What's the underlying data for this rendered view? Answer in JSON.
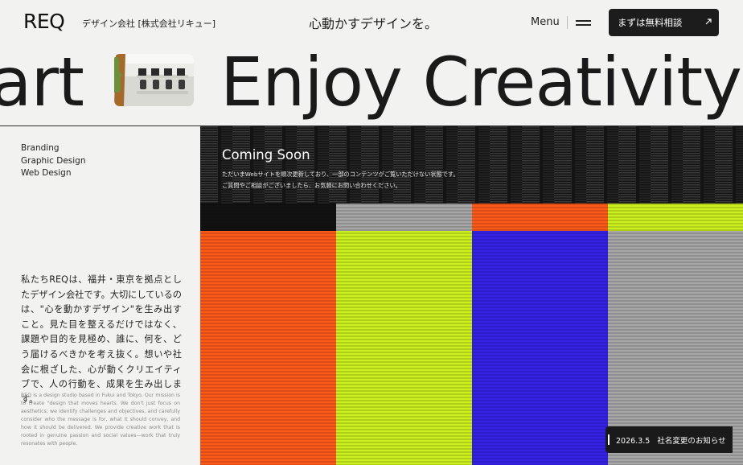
{
  "header": {
    "logo": "REQ",
    "company": "デザイン会社 [株式会社リキュー]",
    "tagline": "心動かすデザインを。",
    "menu_label": "Menu",
    "cta_label": "まずは無料相談",
    "cta_icon": "arrow-up-right-icon",
    "menu_icon": "hamburger-icon"
  },
  "marquee": {
    "left_text": "art",
    "right_text": "Enjoy Creativity"
  },
  "services": [
    "Branding",
    "Graphic Design",
    "Web Design"
  ],
  "intro": {
    "ja": "私たちREQは、福井・東京を拠点としたデザイン会社です。大切にしているのは、\"心を動かすデザイン\"を生み出すこと。見た目を整えるだけではなく、課題や目的を見極め、誰に、何を、どう届けるべきかを考え抜く。想いや社会に根ざした、心が動くクリエイティブで、人の行動を、成果を生み出します。",
    "en": "REQ is a design studio based in Fukui and Tokyo. Our mission is to create \"design that moves hearts. We don't just focus on aesthetics; we identify challenges and objectives, and carefully consider who the message is for, what it should convey, and how it should be delivered. We provide creative work that is rooted in genuine passion and social values—work that truly resonates with people."
  },
  "coming_soon": {
    "title": "Coming Soon",
    "line1": "ただいまWebサイトを順次更新しており、一部のコンテンツがご覧いただけない状態です。",
    "line2": "ご質問やご相談がございましたら、お気軽にお問い合わせください。"
  },
  "news": {
    "date": "2026.3.5",
    "title": "社名変更のお知らせ"
  },
  "colors": {
    "orange": "#ff5a1a",
    "lime": "#ccf01e",
    "blue": "#3322e6",
    "gray": "#a7a7a7",
    "dark": "#1c1c1c"
  }
}
